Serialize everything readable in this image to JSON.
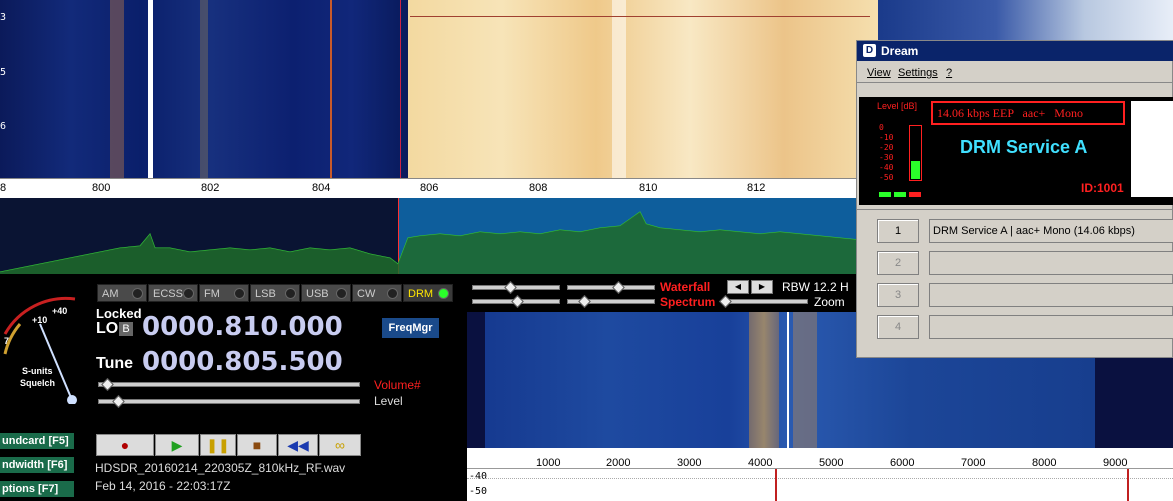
{
  "top_waterfall": {
    "y_labels": [
      "3",
      "5",
      "6"
    ],
    "freq_labels": [
      "8",
      "800",
      "802",
      "804",
      "806",
      "808",
      "810",
      "812"
    ]
  },
  "modes": [
    {
      "label": "AM",
      "active": false
    },
    {
      "label": "ECSS",
      "active": false
    },
    {
      "label": "FM",
      "active": false
    },
    {
      "label": "LSB",
      "active": false
    },
    {
      "label": "USB",
      "active": false
    },
    {
      "label": "CW",
      "active": false
    },
    {
      "label": "DRM",
      "active": true
    }
  ],
  "meter": {
    "scale_labels": [
      "+40",
      "+10",
      "7"
    ],
    "label1": "S-units",
    "label2": "Squelch"
  },
  "lo": {
    "locked_label": "Locked",
    "lo_label": "LO",
    "b_label": "B",
    "frequency": "0000.810.000",
    "freqmgr_label": "FreqMgr"
  },
  "tune": {
    "label": "Tune",
    "frequency": "0000.805.500"
  },
  "volume": {
    "label": "Volume#",
    "value_fraction": 0.02
  },
  "level": {
    "label": "Level",
    "value_fraction": 0.06
  },
  "function_keys": [
    {
      "label": "undcard [F5]"
    },
    {
      "label": "ndwidth [F6]"
    },
    {
      "label": "ptions  [F7]"
    }
  ],
  "playback": {
    "filename": "HDSDR_20160214_220305Z_810kHz_RF.wav",
    "timestamp": "Feb 14, 2016 - 22:03:17Z"
  },
  "waterfall_controls": {
    "waterfall_label": "Waterfall",
    "spectrum_label": "Spectrum",
    "rbw_label": "RBW 12.2 H",
    "zoom_label": "Zoom"
  },
  "bottom_axis": {
    "labels": [
      "1000",
      "2000",
      "3000",
      "4000",
      "5000",
      "6000",
      "7000",
      "8000",
      "9000"
    ]
  },
  "bottom_spectrum": {
    "db_labels": [
      "-40",
      "-50"
    ]
  },
  "dream": {
    "title": "Dream",
    "menu": [
      "View",
      "Settings",
      "?"
    ],
    "level_label": "Level [dB]",
    "level_scale": [
      "0",
      "-10",
      "-20",
      "-30",
      "-40",
      "-50"
    ],
    "info_line": "14.06 kbps EEP   aac+   Mono",
    "service_name": "DRM Service A",
    "id_label": "ID:1001",
    "services": [
      {
        "num": "1",
        "label": "DRM Service A  |   aac+ Mono (14.06 kbps)"
      },
      {
        "num": "2",
        "label": ""
      },
      {
        "num": "3",
        "label": ""
      },
      {
        "num": "4",
        "label": ""
      }
    ]
  },
  "colors": {
    "waterfall_bg": "#0a1a5c",
    "drm_active": "#ffe600",
    "led_green": "#2aff2a",
    "red_label": "#ff2020",
    "dream_title": "#0a246a",
    "dream_cyan": "#40e0ff"
  }
}
